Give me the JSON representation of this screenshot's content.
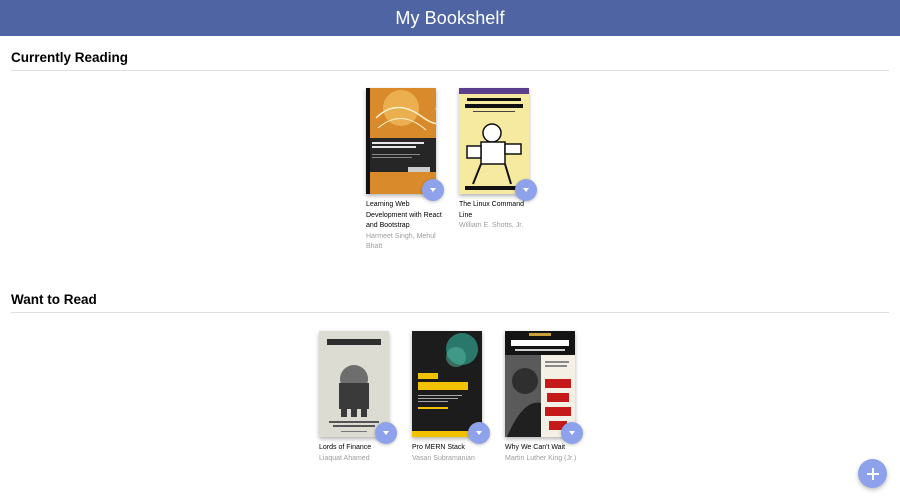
{
  "app": {
    "title": "My Bookshelf"
  },
  "shelves": [
    {
      "title": "Currently Reading",
      "books": [
        {
          "title": "Learning Web Development with React and Bootstrap",
          "authors": "Harmeet Singh, Mehul Bhatt",
          "cover": {
            "heading": "Learning Web Development with React and Bootstrap",
            "publisher": "PACKT"
          }
        },
        {
          "title": "The Linux Command Line",
          "authors": "William E. Shotts, Jr.",
          "cover": {
            "heading": "THE LINUX COMMAND LINE"
          }
        }
      ]
    },
    {
      "title": "Want to Read",
      "books": [
        {
          "title": "Lords of Finance",
          "authors": "Liaquat Ahamed",
          "cover": {
            "heading": "LORDS OF FINANCE",
            "subheading": "THE BANKERS WHO BROKE THE WORLD"
          }
        },
        {
          "title": "Pro MERN Stack",
          "authors": "Vasan Subramanian",
          "cover": {
            "heading": "Pro MERN Stack"
          }
        },
        {
          "title": "Why We Can't Wait",
          "authors": "Martin Luther King (Jr.)",
          "cover": {
            "heading": "MARTIN LUTHER KING, JR.",
            "subheading": "WHY WE CAN'T WAIT"
          }
        }
      ]
    }
  ],
  "icons": {
    "shelf_changer": "triangle-down-icon",
    "add": "plus-icon"
  },
  "colors": {
    "header": "#4f64a3",
    "accent_button": "#8da2ea",
    "author_text": "#9e9e9e",
    "divider": "#dedede"
  }
}
